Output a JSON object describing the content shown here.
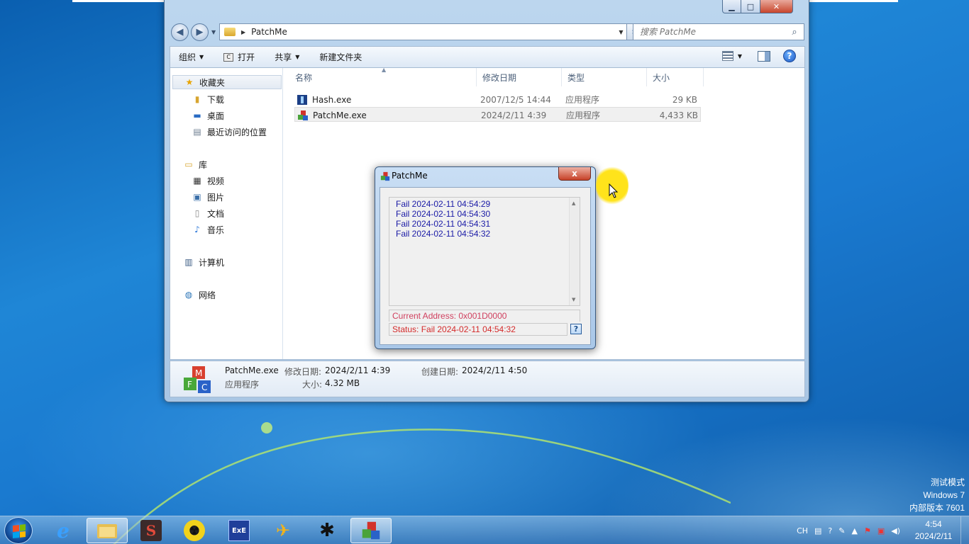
{
  "explorer": {
    "address_path": "PatchMe",
    "search_placeholder": "搜索 PatchMe",
    "toolbar": {
      "organize": "组织",
      "open": "打开",
      "share": "共享",
      "new_folder": "新建文件夹"
    },
    "nav": {
      "favorites": "收藏夹",
      "downloads": "下载",
      "desktop": "桌面",
      "recent": "最近访问的位置",
      "libraries": "库",
      "videos": "视频",
      "pictures": "图片",
      "documents": "文档",
      "music": "音乐",
      "computer": "计算机",
      "network": "网络"
    },
    "columns": {
      "name": "名称",
      "modified": "修改日期",
      "type": "类型",
      "size": "大小"
    },
    "files": [
      {
        "name": "Hash.exe",
        "modified": "2007/12/5 14:44",
        "type": "应用程序",
        "size": "29 KB"
      },
      {
        "name": "PatchMe.exe",
        "modified": "2024/2/11 4:39",
        "type": "应用程序",
        "size": "4,433 KB"
      }
    ],
    "details": {
      "filename": "PatchMe.exe",
      "modified_label": "修改日期:",
      "modified_value": "2024/2/11 4:39",
      "created_label": "创建日期:",
      "created_value": "2024/2/11 4:50",
      "type": "应用程序",
      "size_label": "大小:",
      "size_value": "4.32 MB"
    }
  },
  "dialog": {
    "title": "PatchMe",
    "close_label": "x",
    "log_lines": [
      "Fail 2024-02-11 04:54:29",
      "Fail 2024-02-11 04:54:30",
      "Fail 2024-02-11 04:54:31",
      "Fail 2024-02-11 04:54:32"
    ],
    "current_address": "Current Address: 0x001D0000",
    "status": "Status: Fail 2024-02-11 04:54:32",
    "help_label": "?"
  },
  "desktop": {
    "watermark_line1": "测试模式",
    "watermark_line2": "Windows 7",
    "watermark_line3": "内部版本 7601"
  },
  "taskbar": {
    "lang": "CH",
    "time": "4:54",
    "date": "2024/2/11"
  },
  "colors": {
    "log_text": "#1a1aa6",
    "address_text": "#d0405f",
    "status_text": "#d42a2a",
    "desktop_blue": "#1f86d6"
  }
}
